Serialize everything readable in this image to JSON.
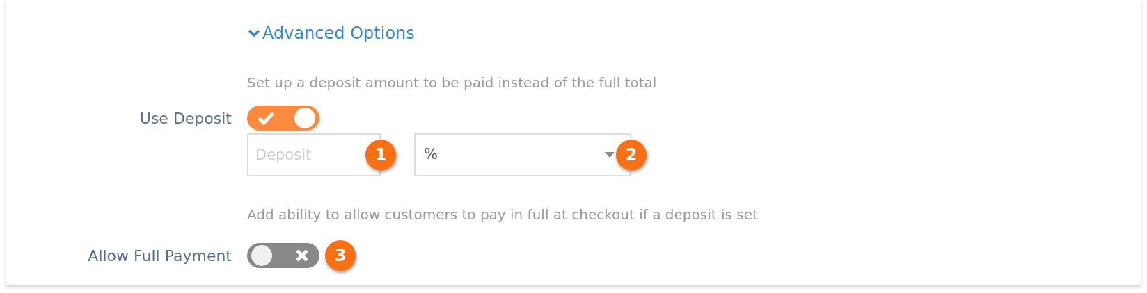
{
  "advanced_toggle": {
    "label": "Advanced Options",
    "expanded": true
  },
  "deposit_help": "Set up a deposit amount to be paid instead of the full total",
  "use_deposit": {
    "label": "Use Deposit",
    "on": true
  },
  "deposit_field": {
    "placeholder": "Deposit",
    "callout": "1"
  },
  "deposit_type": {
    "value": "%",
    "callout": "2"
  },
  "full_payment_help": "Add ability to allow customers to pay in full at checkout if a deposit is set",
  "allow_full_payment": {
    "label": "Allow Full Payment",
    "on": false,
    "callout": "3"
  }
}
